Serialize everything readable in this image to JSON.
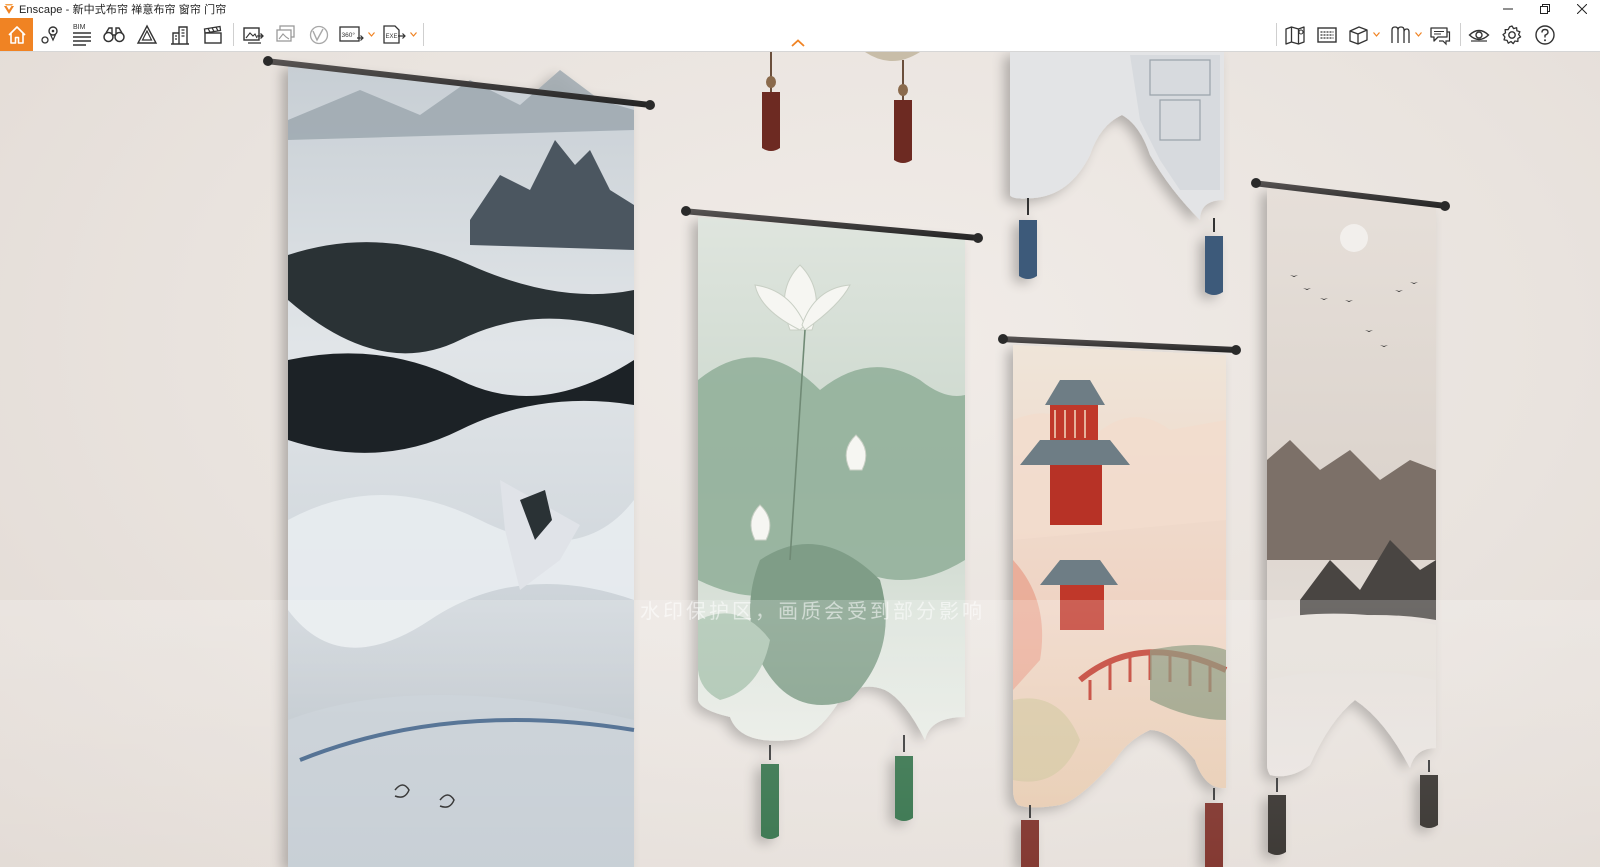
{
  "window": {
    "title": "Enscape - 新中式布帘 禅意布帘 窗帘 门帘",
    "controls": [
      "minimize-icon",
      "restore-icon",
      "close-icon"
    ]
  },
  "toolbar": {
    "accent_color": "#f08323",
    "left_tools": [
      {
        "name": "home-icon",
        "active": true
      },
      {
        "name": "views-icon"
      },
      {
        "name": "bim-icon",
        "label": "BIM"
      },
      {
        "name": "binoculars-icon"
      },
      {
        "name": "assets-icon"
      },
      {
        "name": "buildings-icon"
      },
      {
        "name": "clapboard-icon"
      },
      {
        "name": "screenshot-icon"
      },
      {
        "name": "batch-render-icon"
      },
      {
        "name": "vr-icon"
      },
      {
        "name": "panorama-icon",
        "label": "360°"
      },
      {
        "name": "export-exe-icon",
        "label": "EXE"
      }
    ],
    "right_tools": [
      {
        "name": "map-icon"
      },
      {
        "name": "keyboard-icon"
      },
      {
        "name": "cube-icon"
      },
      {
        "name": "material-icon"
      },
      {
        "name": "chat-icon"
      },
      {
        "name": "eye-icon"
      },
      {
        "name": "settings-icon"
      },
      {
        "name": "help-icon"
      }
    ]
  },
  "viewport": {
    "watermark": "水印保护区，画质会受到部分影响",
    "background_color": "#ece6e1"
  }
}
